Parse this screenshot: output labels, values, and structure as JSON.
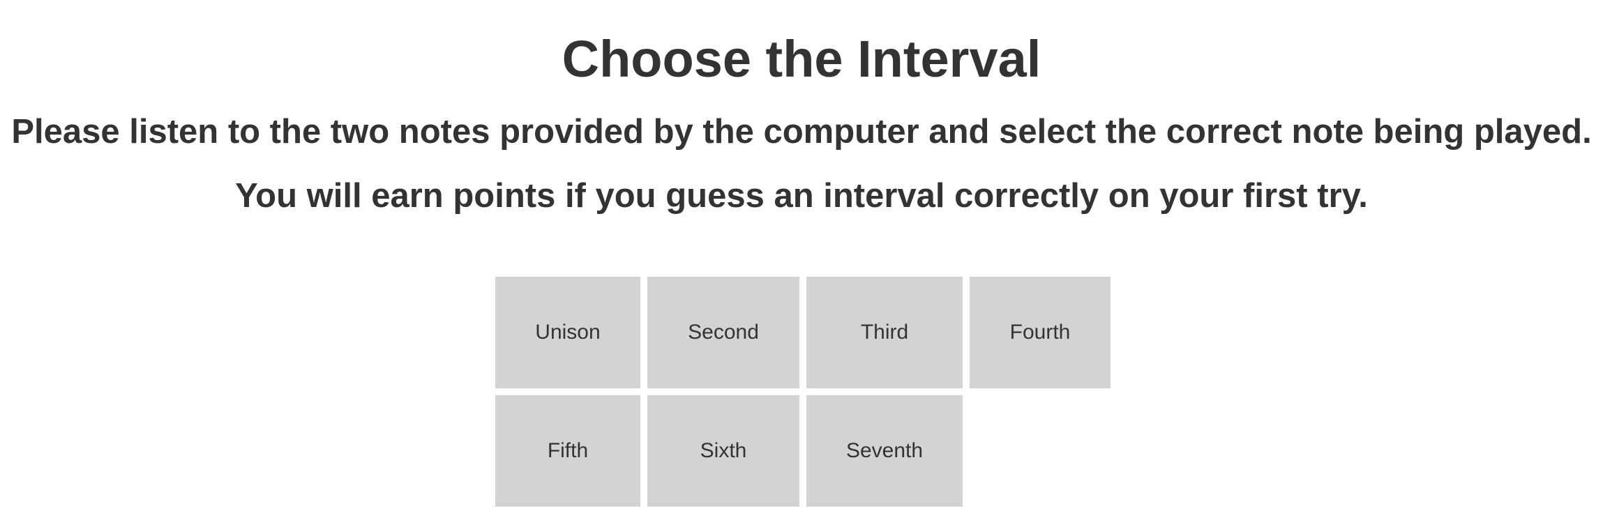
{
  "header": {
    "title": "Choose the Interval",
    "instruction": "Please listen to the two notes provided by the computer and select the correct note being played.",
    "points_note": "You will earn points if you guess an interval correctly on your first try."
  },
  "intervals": [
    {
      "label": "Unison"
    },
    {
      "label": "Second"
    },
    {
      "label": "Third"
    },
    {
      "label": "Fourth"
    },
    {
      "label": "Fifth"
    },
    {
      "label": "Sixth"
    },
    {
      "label": "Seventh"
    }
  ],
  "colors": {
    "text": "#333333",
    "button_bg": "#d3d3d3",
    "page_bg": "#ffffff"
  }
}
